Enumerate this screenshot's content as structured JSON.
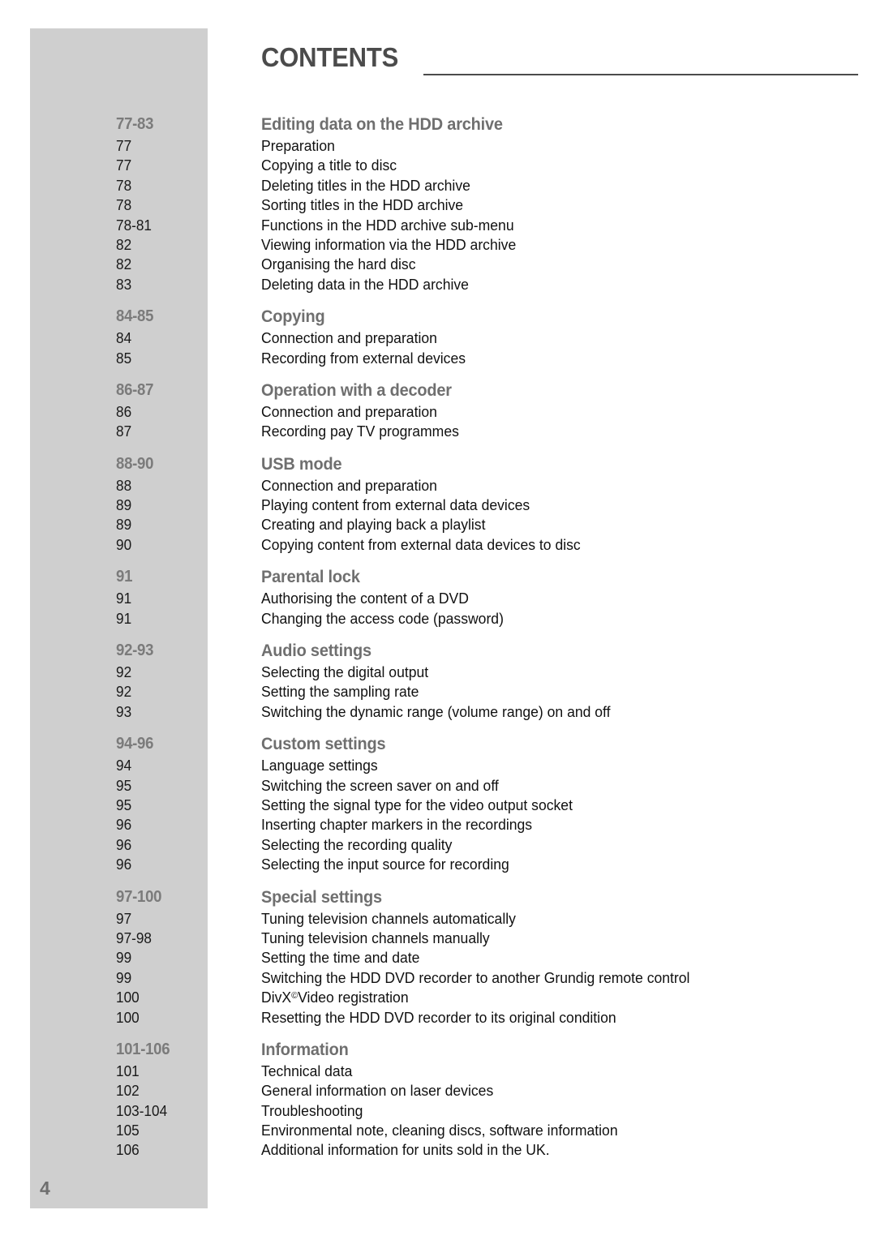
{
  "header": {
    "title": "CONTENTS"
  },
  "folio": "4",
  "sections": [
    {
      "pages": "77-83",
      "heading": "Editing data on the HDD archive",
      "entries": [
        {
          "pages": "77",
          "label": "Preparation"
        },
        {
          "pages": "77",
          "label": "Copying a title to disc"
        },
        {
          "pages": "78",
          "label": "Deleting titles in the HDD archive"
        },
        {
          "pages": "78",
          "label": "Sorting titles in the HDD archive"
        },
        {
          "pages": "78-81",
          "label": "Functions in the HDD archive sub-menu"
        },
        {
          "pages": "82",
          "label": "Viewing information via the HDD archive"
        },
        {
          "pages": "82",
          "label": "Organising the hard disc"
        },
        {
          "pages": "83",
          "label": "Deleting data in the HDD archive"
        }
      ]
    },
    {
      "pages": "84-85",
      "heading": "Copying",
      "entries": [
        {
          "pages": "84",
          "label": "Connection and preparation"
        },
        {
          "pages": "85",
          "label": "Recording from external devices"
        }
      ]
    },
    {
      "pages": "86-87",
      "heading": "Operation with a decoder",
      "entries": [
        {
          "pages": "86",
          "label": "Connection and preparation"
        },
        {
          "pages": "87",
          "label": "Recording pay TV programmes"
        }
      ]
    },
    {
      "pages": "88-90",
      "heading": "USB mode",
      "entries": [
        {
          "pages": "88",
          "label": "Connection and preparation"
        },
        {
          "pages": "89",
          "label": "Playing content from external data devices"
        },
        {
          "pages": "89",
          "label": "Creating and playing back a playlist"
        },
        {
          "pages": "90",
          "label": "Copying content from external data devices to disc"
        }
      ]
    },
    {
      "pages": "91",
      "heading": "Parental lock",
      "entries": [
        {
          "pages": "91",
          "label": "Authorising the content of a DVD"
        },
        {
          "pages": "91",
          "label": "Changing the access code (password)"
        }
      ]
    },
    {
      "pages": "92-93",
      "heading": "Audio settings",
      "entries": [
        {
          "pages": "92",
          "label": "Selecting the digital output"
        },
        {
          "pages": "92",
          "label": "Setting the sampling rate"
        },
        {
          "pages": "93",
          "label": "Switching the dynamic range (volume range) on and off"
        }
      ]
    },
    {
      "pages": "94-96",
      "heading": "Custom settings",
      "entries": [
        {
          "pages": "94",
          "label": "Language settings"
        },
        {
          "pages": "95",
          "label": "Switching the screen saver on and off"
        },
        {
          "pages": "95",
          "label": "Setting the signal type for the video output socket"
        },
        {
          "pages": "96",
          "label": "Inserting chapter markers in the recordings"
        },
        {
          "pages": "96",
          "label": "Selecting the recording quality"
        },
        {
          "pages": "96",
          "label": "Selecting the input source for recording"
        }
      ]
    },
    {
      "pages": "97-100",
      "heading": "Special settings",
      "entries": [
        {
          "pages": "97",
          "label": "Tuning television channels automatically"
        },
        {
          "pages": "97-98",
          "label": "Tuning television channels manually"
        },
        {
          "pages": "99",
          "label": "Setting the time and date"
        },
        {
          "pages": "99",
          "label": "Switching the HDD DVD recorder to another Grundig remote control"
        },
        {
          "pages": "100",
          "label": "DivX",
          "sup": "©",
          "label_tail": "Video registration"
        },
        {
          "pages": "100",
          "label": "Resetting the HDD DVD recorder to its original condition"
        }
      ]
    },
    {
      "pages": "101-106",
      "heading": "Information",
      "entries": [
        {
          "pages": "101",
          "label": "Technical data"
        },
        {
          "pages": "102",
          "label": "General information on laser devices"
        },
        {
          "pages": "103-104",
          "label": "Troubleshooting"
        },
        {
          "pages": "105",
          "label": "Environmental note, cleaning discs, software information"
        },
        {
          "pages": "106",
          "label": "Additional information for units sold in the UK."
        }
      ]
    }
  ]
}
